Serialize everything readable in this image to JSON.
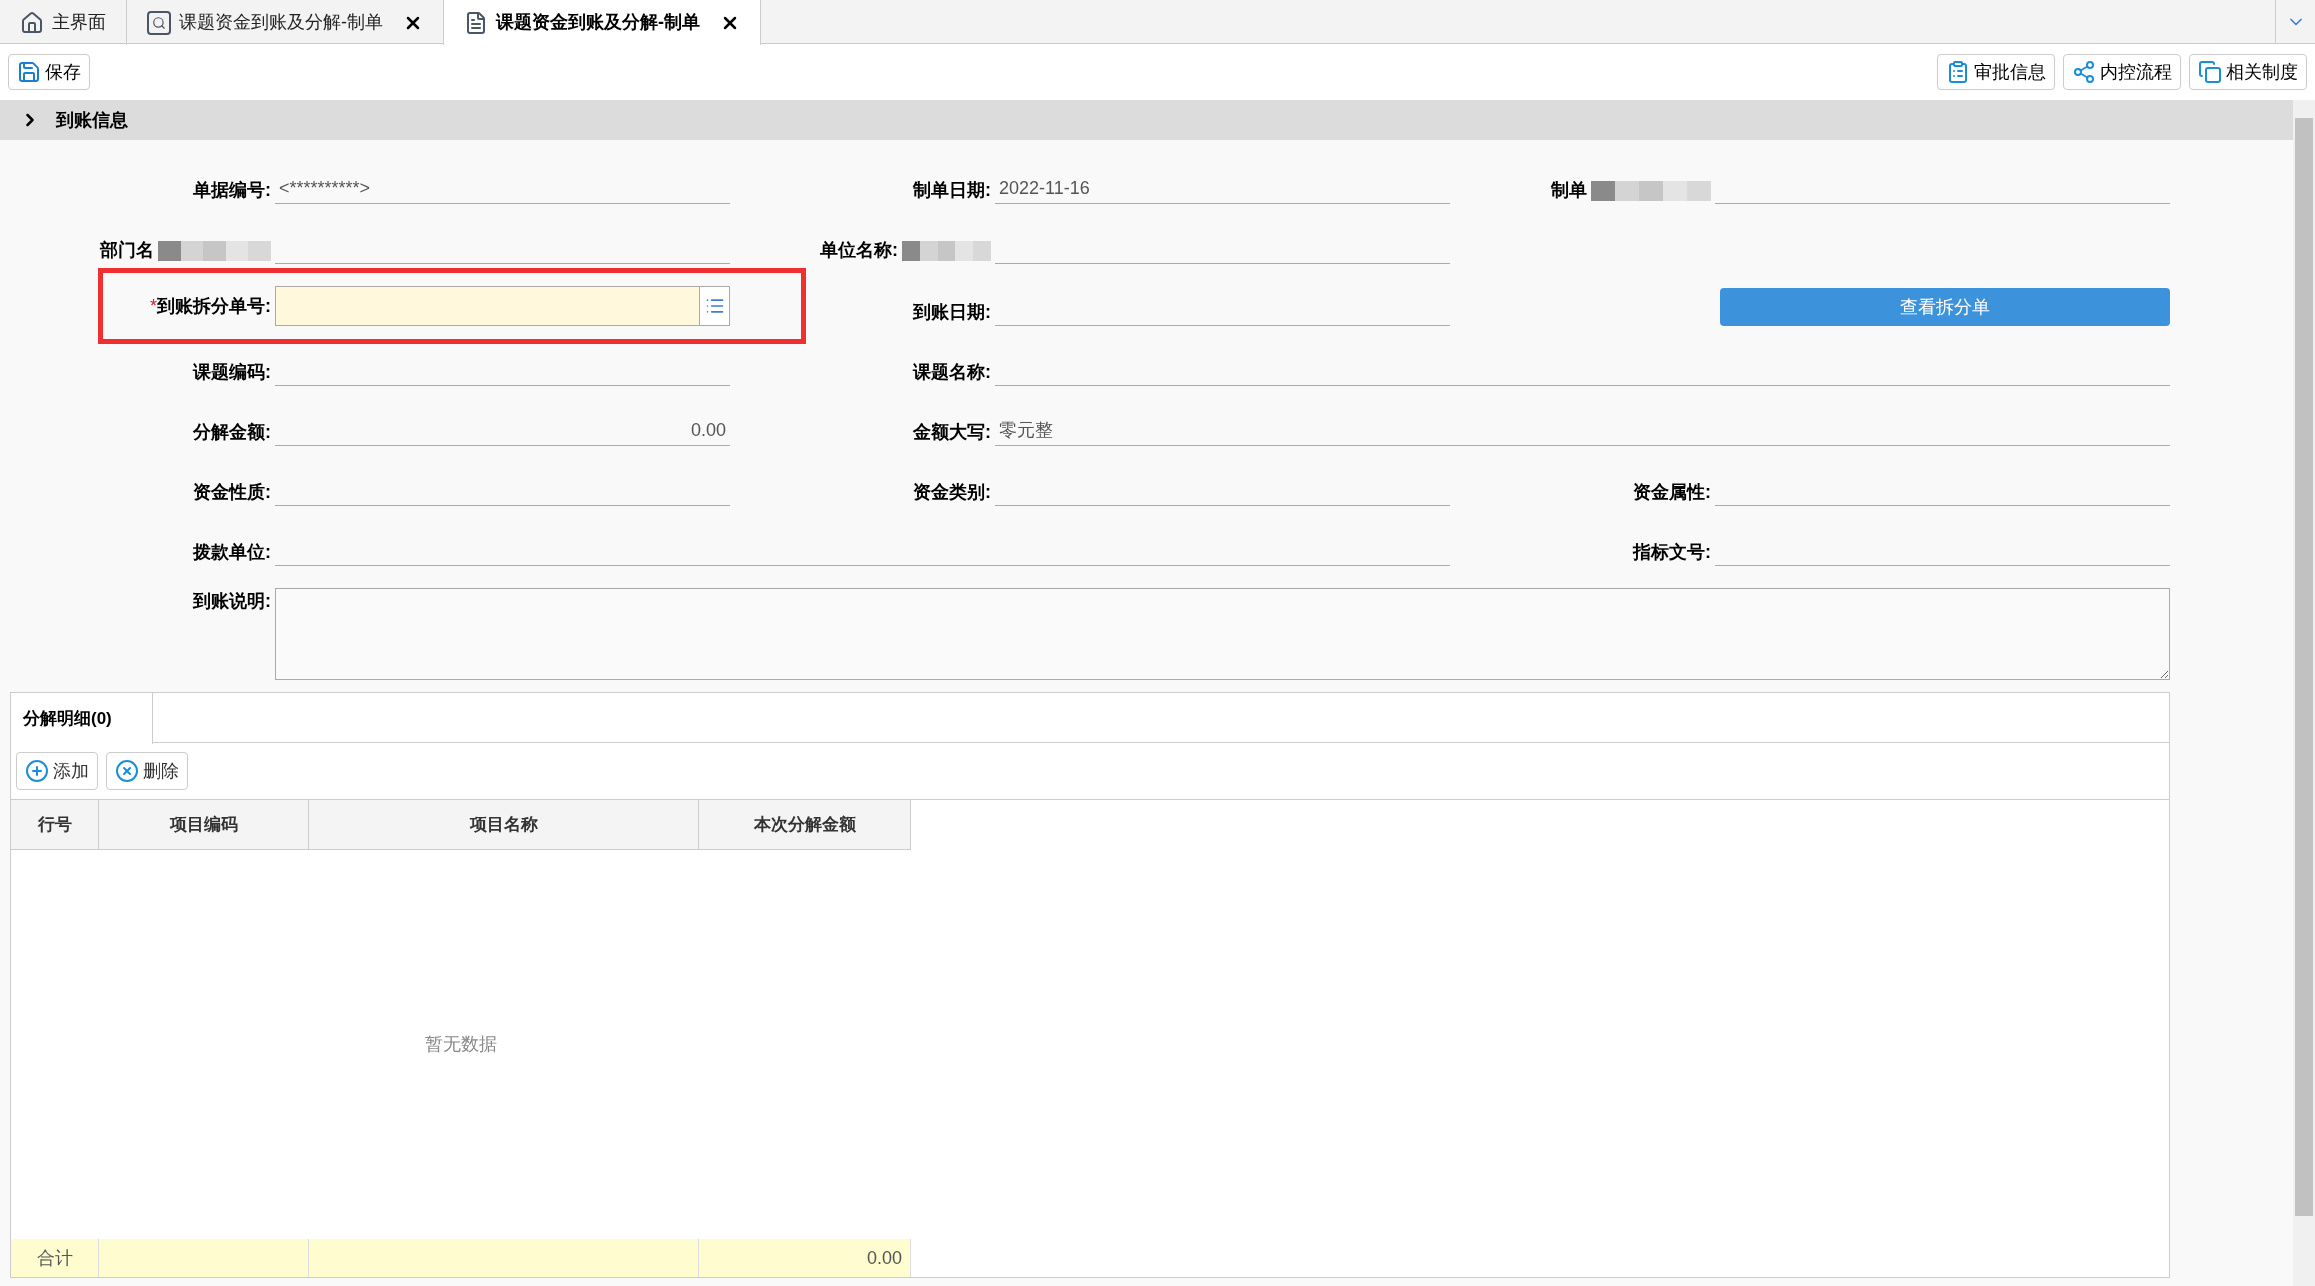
{
  "tabs": [
    {
      "label": "主界面",
      "kind": "home",
      "closable": false,
      "selected": false
    },
    {
      "label": "课题资金到账及分解-制单",
      "kind": "search",
      "closable": true,
      "selected": false
    },
    {
      "label": "课题资金到账及分解-制单",
      "kind": "doc",
      "closable": true,
      "selected": true
    }
  ],
  "toolbar": {
    "left": [
      {
        "label": "保存",
        "kind": "save"
      }
    ],
    "right": [
      {
        "label": "审批信息",
        "kind": "clipboard"
      },
      {
        "label": "内控流程",
        "kind": "share"
      },
      {
        "label": "相关制度",
        "kind": "copy"
      }
    ]
  },
  "section": {
    "title": "到账信息"
  },
  "form": {
    "rows": [
      {
        "cells": [
          {
            "kind": "text",
            "label": "单据编号:",
            "value": "<**********>"
          },
          {
            "kind": "text",
            "label": "制单日期:",
            "value": "2022-11-16"
          },
          {
            "kind": "text",
            "label": "制单",
            "redacted": true
          }
        ]
      },
      {
        "cells": [
          {
            "kind": "text",
            "label": "部门名",
            "redacted": true
          },
          {
            "kind": "text",
            "label": "单位名称:",
            "redacted": true
          }
        ]
      },
      {
        "cells": [
          {
            "kind": "lookup",
            "label": "到账拆分单号:",
            "required_mark": "*",
            "highlighted": true
          },
          {
            "kind": "text",
            "label": "到账日期:"
          },
          {
            "kind": "button",
            "label": "查看拆分单"
          }
        ]
      },
      {
        "cells": [
          {
            "kind": "text",
            "label": "课题编码:"
          },
          {
            "kind": "wide",
            "label": "课题名称:"
          }
        ]
      },
      {
        "cells": [
          {
            "kind": "number",
            "label": "分解金额:",
            "value": "0.00"
          },
          {
            "kind": "wide",
            "label": "金额大写:",
            "value": "零元整"
          }
        ]
      },
      {
        "cells": [
          {
            "kind": "text",
            "label": "资金性质:"
          },
          {
            "kind": "text",
            "label": "资金类别:"
          },
          {
            "kind": "text",
            "label": "资金属性:"
          }
        ]
      },
      {
        "cells": [
          {
            "kind": "wide",
            "label": "拨款单位:"
          },
          {
            "kind": "text",
            "label": "指标文号:"
          }
        ]
      },
      {
        "cells": [
          {
            "kind": "memo",
            "label": "到账说明:"
          }
        ]
      }
    ]
  },
  "detail": {
    "tab": "分解明细(0)",
    "buttons": [
      {
        "label": "添加",
        "kind": "add"
      },
      {
        "label": "删除",
        "kind": "delete"
      }
    ],
    "table": {
      "columns": [
        "行号",
        "项目编码",
        "项目名称",
        "本次分解金额"
      ],
      "empty_text": "暂无数据",
      "footer": {
        "label": "合计",
        "total": "0.00"
      }
    }
  }
}
